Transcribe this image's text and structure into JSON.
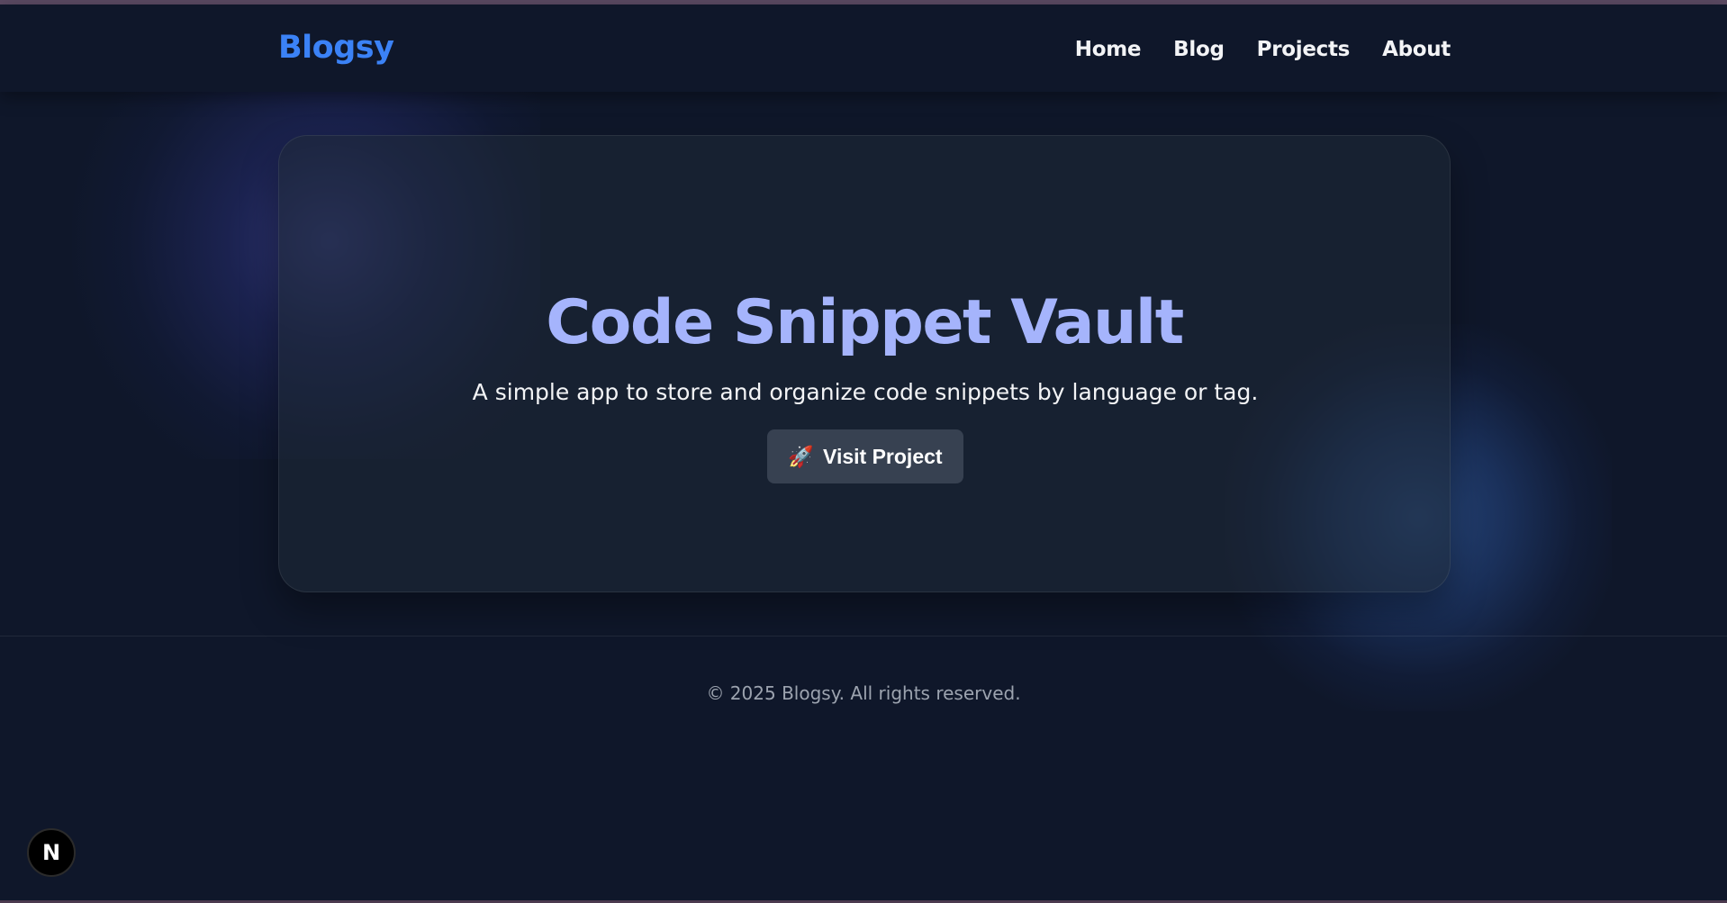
{
  "header": {
    "logo": "Blogsy",
    "nav": [
      "Home",
      "Blog",
      "Projects",
      "About"
    ]
  },
  "hero": {
    "title": "Code Snippet Vault",
    "description": "A simple app to store and organize code snippets by language or tag.",
    "button_icon": "🚀",
    "button_label": "Visit Project"
  },
  "footer": {
    "text": "© 2025 Blogsy. All rights reserved."
  },
  "dev_badge": {
    "label": "N",
    "icon": "nextjs-icon"
  },
  "colors": {
    "background": "#0f172a",
    "logo": "#3b82f6",
    "title": "#a5b4fc",
    "button": "#374151"
  }
}
